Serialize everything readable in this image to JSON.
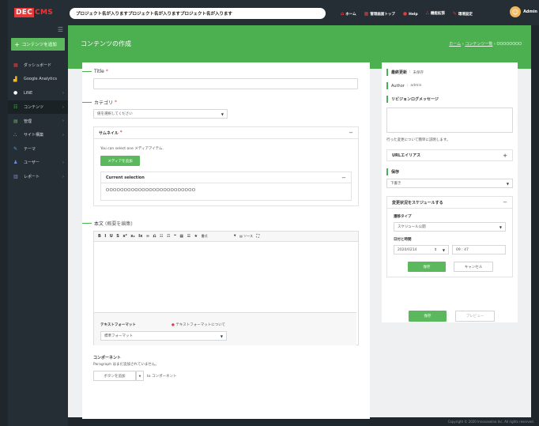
{
  "brand": {
    "part1": "DEC",
    "part2": "CMS"
  },
  "sidebar": {
    "add_button": "コンテンツを追加",
    "items": [
      {
        "icon": "dashboard-icon",
        "glyph": "▦",
        "label": "ダッシュボード",
        "color": "#e5393a",
        "has_arrow": false
      },
      {
        "icon": "analytics-icon",
        "glyph": "▟",
        "label": "Google Analytics",
        "color": "#f5b82e",
        "has_arrow": false
      },
      {
        "icon": "line-icon",
        "glyph": "●",
        "label": "LINE",
        "color": "#ffffff",
        "has_arrow": true
      },
      {
        "icon": "content-icon",
        "glyph": "☷",
        "label": "コンテンツ",
        "color": "#5cb85c",
        "has_arrow": true
      },
      {
        "icon": "admin-icon",
        "glyph": "▤",
        "label": "管理",
        "color": "#5cb85c",
        "has_arrow": true
      },
      {
        "icon": "site-icon",
        "glyph": "⛬",
        "label": "サイト構築",
        "color": "#3fa9f5",
        "has_arrow": true
      },
      {
        "icon": "theme-icon",
        "glyph": "✎",
        "label": "テーマ",
        "color": "#3fa9f5",
        "has_arrow": false
      },
      {
        "icon": "user-icon",
        "glyph": "♟",
        "label": "ユーザー",
        "color": "#6c8fd9",
        "has_arrow": true
      },
      {
        "icon": "report-icon",
        "glyph": "▥",
        "label": "レポート",
        "color": "#6c8fd9",
        "has_arrow": true
      }
    ]
  },
  "topbar": {
    "project_name": "プロジェクト名が入りますプロジェクト名が入りますプロジェクト名が入ります",
    "links": [
      "ホーム",
      "管理画面トップ",
      "Help",
      "機能拡張",
      "環境設定"
    ],
    "admin": "Admin"
  },
  "page": {
    "title": "コンテンツの作成",
    "breadcrumb": {
      "home": "ホーム",
      "sep": "›",
      "list": "コンテンツ一覧",
      "current": "OOOOOOOO"
    }
  },
  "form": {
    "title_label": "Title",
    "req": "*",
    "category_label": "カテゴリ",
    "category_placeholder": "値を選択してください",
    "thumbnail": {
      "heading": "サムネイル",
      "note": "You can select one メディアアイテム.",
      "add_button": "メディアを追加",
      "selection_heading": "Current selection",
      "selection_value": "OOOOOOOOOOOOOOOOOOOOOOOOO"
    },
    "body_label": "本文",
    "body_edit": "(概要を編集)",
    "toolbar": {
      "buttons": [
        "B",
        "I",
        "U",
        "S",
        "x²",
        "x₂",
        "Ix",
        "∞",
        "⎌",
        "☷",
        "☶",
        "❝",
        "▦",
        "☰",
        "★"
      ],
      "format": "書式",
      "source": "ソース",
      "expand": "⛶"
    },
    "text_format_label": "テキストフォーマット",
    "text_format_help": "テキストフォーマットについて",
    "text_format_value": "標準フォーマット",
    "component_label": "コンポーネント",
    "component_note": "Paragraph はまだ追加されていません。",
    "component_button": "ボタンを追加",
    "component_to": "to コンポーネント"
  },
  "side": {
    "last_updated_label": "最終更新",
    "last_updated_value": "未保存",
    "author_label": "Author",
    "author_value": "admin",
    "revision_label": "リビジョンログメッセージ",
    "revision_help": "行った変更について簡単に説明します。",
    "url_alias": "URLエイリアス",
    "save_label": "保存",
    "save_state": "下書き",
    "schedule_heading": "変更状況をスケジュールする",
    "transition_label": "遷移タイプ",
    "transition_value": "スケジュール公開",
    "datetime_label": "日付と時間",
    "date_value": "2020/0214",
    "time_value": "09 : 47",
    "schedule_save": "保存",
    "schedule_cancel": "キャンセル"
  },
  "actions": {
    "save": "保存",
    "preview": "プレビュー"
  },
  "footer": {
    "copyright": "Copyright © 2020 Innovaxelno Inc. All rights reserved."
  }
}
